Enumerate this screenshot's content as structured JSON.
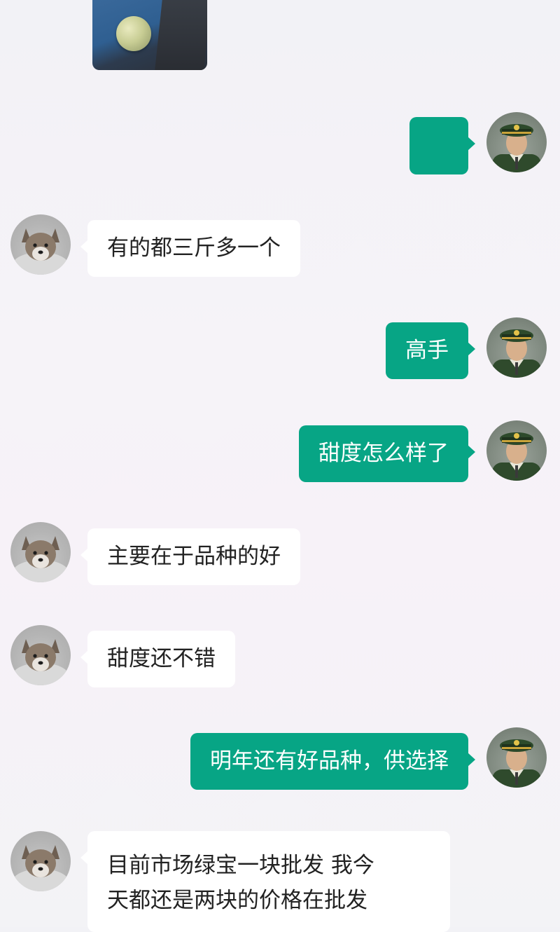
{
  "colors": {
    "outgoing_bubble": "#07a585",
    "incoming_bubble": "#ffffff",
    "background": "#f4f3f7"
  },
  "avatars": {
    "incoming": "dog-avatar",
    "outgoing": "officer-avatar"
  },
  "messages": [
    {
      "direction": "in",
      "type": "image"
    },
    {
      "direction": "out",
      "text": ""
    },
    {
      "direction": "in",
      "text": "有的都三斤多一个"
    },
    {
      "direction": "out",
      "text": "高手"
    },
    {
      "direction": "out",
      "text": "甜度怎么样了"
    },
    {
      "direction": "in",
      "text": "主要在于品种的好"
    },
    {
      "direction": "in",
      "text": "甜度还不错"
    },
    {
      "direction": "out",
      "text": "明年还有好品种，供选择"
    },
    {
      "direction": "in",
      "lines": [
        "目前市场绿宝一块批发  我今",
        "天都还是两块的价格在批发"
      ]
    }
  ]
}
